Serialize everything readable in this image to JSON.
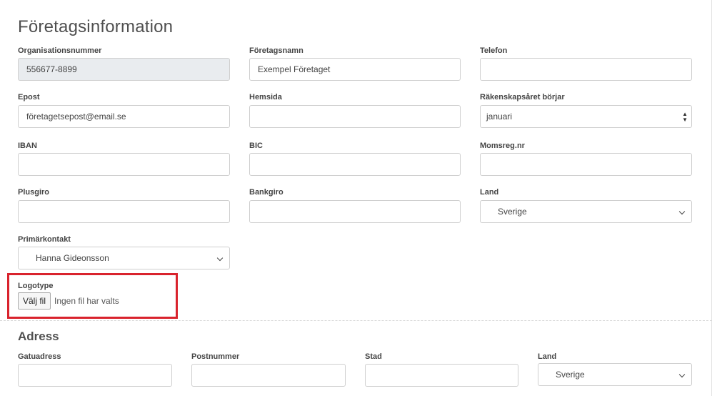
{
  "page": {
    "title": "Företagsinformation"
  },
  "company": {
    "org_number": {
      "label": "Organisationsnummer",
      "value": "556677-8899"
    },
    "company_name": {
      "label": "Företagsnamn",
      "value": "Exempel Företaget"
    },
    "phone": {
      "label": "Telefon",
      "value": ""
    },
    "email": {
      "label": "Epost",
      "value": "företagetsepost@email.se"
    },
    "website": {
      "label": "Hemsida",
      "value": ""
    },
    "fiscal_year_start": {
      "label": "Räkenskapsåret börjar",
      "value": "januari"
    },
    "iban": {
      "label": "IBAN",
      "value": ""
    },
    "bic": {
      "label": "BIC",
      "value": ""
    },
    "vat_number": {
      "label": "Momsreg.nr",
      "value": ""
    },
    "plusgiro": {
      "label": "Plusgiro",
      "value": ""
    },
    "bankgiro": {
      "label": "Bankgiro",
      "value": ""
    },
    "country": {
      "label": "Land",
      "value": "Sverige"
    },
    "primary_contact": {
      "label": "Primärkontakt",
      "value": "Hanna Gideonsson"
    },
    "logo": {
      "label": "Logotype",
      "button_label": "Välj fil",
      "status": "Ingen fil har valts"
    }
  },
  "address": {
    "title": "Adress",
    "street": {
      "label": "Gatuadress",
      "value": ""
    },
    "postal_code": {
      "label": "Postnummer",
      "value": ""
    },
    "city": {
      "label": "Stad",
      "value": ""
    },
    "country": {
      "label": "Land",
      "value": "Sverige"
    }
  },
  "colors": {
    "highlight": "#d9232d",
    "readonly_bg": "#e9ecef"
  }
}
